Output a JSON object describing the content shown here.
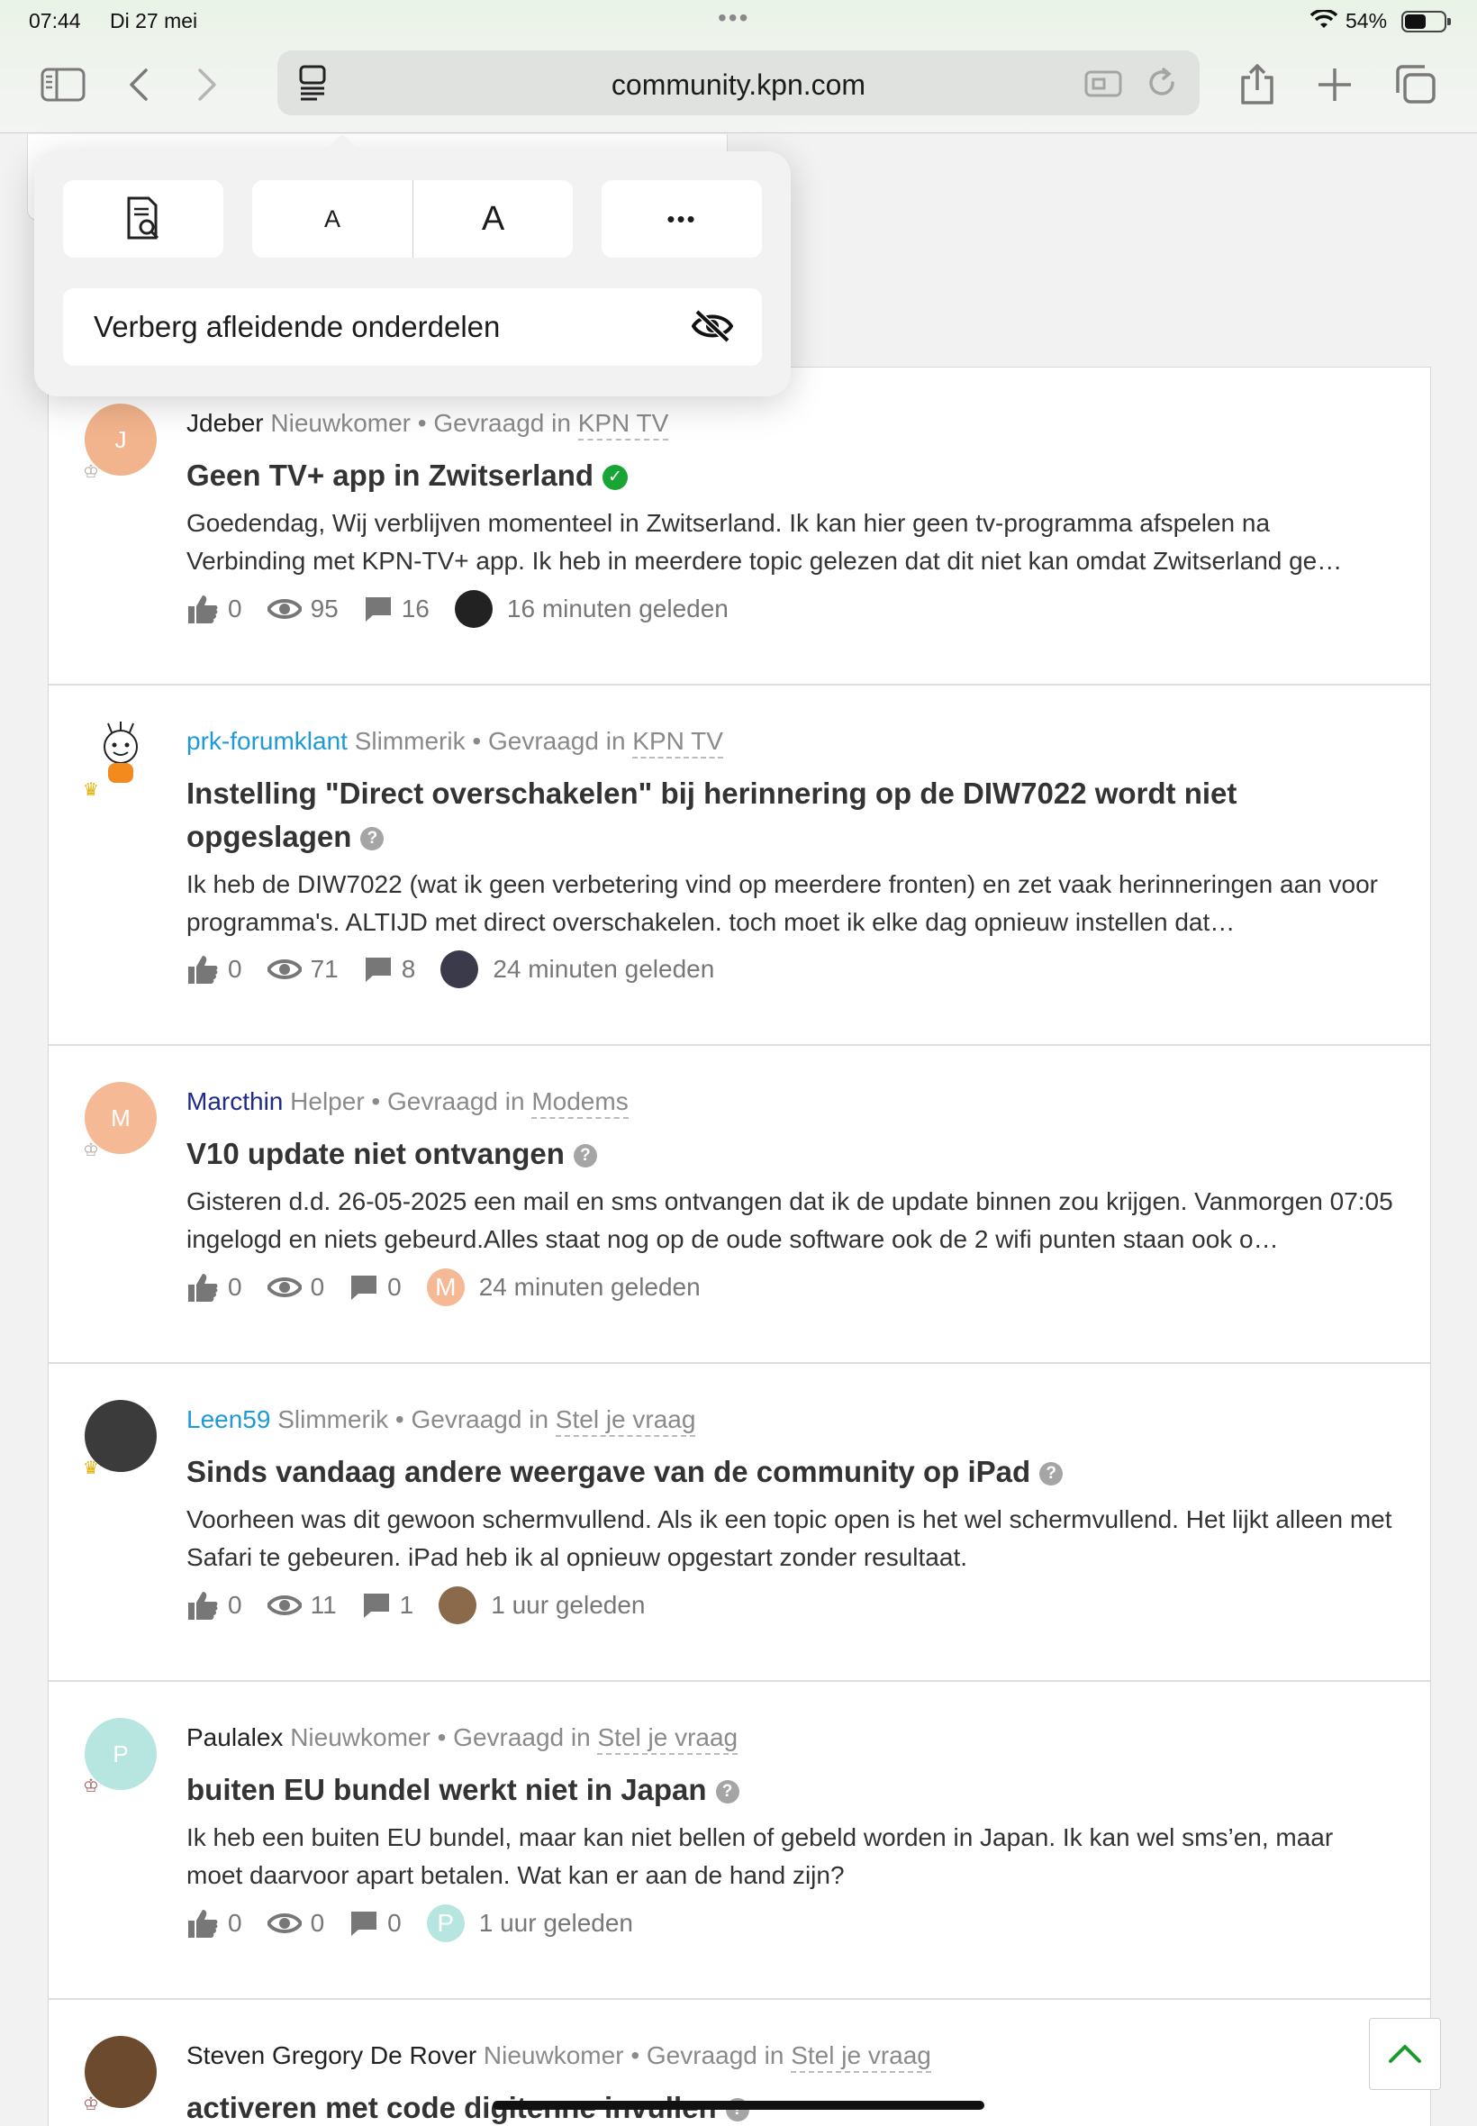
{
  "status_bar": {
    "time": "07:44",
    "date": "Di 27 mei",
    "battery_pct": "54%",
    "battery_level": 0.54
  },
  "browser": {
    "url": "community.kpn.com"
  },
  "popover": {
    "font_small": "A",
    "font_large": "A",
    "more": "•••",
    "hide_distracting": "Verberg afleidende onderdelen"
  },
  "topics": [
    {
      "author": "Jdeber",
      "rank": "Nieuwkomer",
      "asked_in": "• Gevraagd in",
      "category": "KPN TV",
      "avatar_letter": "J",
      "title": "Geen TV+ app in Zwitserland",
      "status": "solved",
      "excerpt": "Goedendag, Wij verblijven momenteel in Zwitserland. Ik kan hier geen tv-programma afspelen na Verbinding met KPN-TV+ app. Ik heb in meerdere topic gelezen dat dit niet kan omdat Zwitserland ge…",
      "likes": "0",
      "views": "95",
      "replies": "16",
      "time": "16 minuten geleden"
    },
    {
      "author": "prk-forumklant",
      "rank": "Slimmerik",
      "asked_in": "• Gevraagd in",
      "category": "KPN TV",
      "avatar_letter": "",
      "title": "Instelling \"Direct overschakelen\" bij herinnering op de DIW7022 wordt niet opgeslagen",
      "status": "question",
      "excerpt": "Ik heb de DIW7022 (wat ik geen verbetering vind op meerdere fronten) en zet vaak herinneringen aan voor programma's. ALTIJD met direct overschakelen. toch moet ik elke dag opnieuw instellen dat…",
      "likes": "0",
      "views": "71",
      "replies": "8",
      "time": "24 minuten geleden"
    },
    {
      "author": "Marcthin",
      "rank": "Helper",
      "asked_in": "• Gevraagd in",
      "category": "Modems",
      "avatar_letter": "M",
      "title": "V10 update niet ontvangen",
      "status": "question",
      "excerpt": "Gisteren d.d. 26-05-2025 een mail en sms ontvangen dat ik de update binnen zou krijgen. Vanmorgen 07:05 ingelogd en niets gebeurd.Alles staat nog op de oude software ook de 2 wifi punten staan ook o…",
      "likes": "0",
      "views": "0",
      "replies": "0",
      "time": "24 minuten geleden"
    },
    {
      "author": "Leen59",
      "rank": "Slimmerik",
      "asked_in": "• Gevraagd in",
      "category": "Stel je vraag",
      "avatar_letter": "",
      "title": "Sinds vandaag andere weergave van de community op iPad",
      "status": "question",
      "excerpt": "Voorheen was dit gewoon schermvullend. Als ik een topic open is het wel schermvullend. Het lijkt alleen met Safari te gebeuren. iPad heb ik al opnieuw opgestart zonder resultaat.",
      "likes": "0",
      "views": "11",
      "replies": "1",
      "time": "1 uur geleden"
    },
    {
      "author": "Paulalex",
      "rank": "Nieuwkomer",
      "asked_in": "• Gevraagd in",
      "category": "Stel je vraag",
      "avatar_letter": "P",
      "title": "buiten EU bundel werkt niet in Japan",
      "status": "question",
      "excerpt": "Ik heb een buiten EU bundel, maar kan niet bellen of gebeld worden in Japan. Ik kan wel sms’en, maar moet daarvoor apart betalen. Wat kan er aan de hand zijn?",
      "likes": "0",
      "views": "0",
      "replies": "0",
      "time": "1 uur geleden"
    },
    {
      "author": "Steven Gregory De Rover",
      "rank": "Nieuwkomer",
      "asked_in": "• Gevraagd in",
      "category": "Stel je vraag",
      "avatar_letter": "",
      "title": "activeren met code digitenne invullen",
      "status": "question"
    }
  ],
  "colors": {
    "solved": "#18a535",
    "link_blue": "#1f9ad6",
    "navy": "#1f2a8a"
  }
}
